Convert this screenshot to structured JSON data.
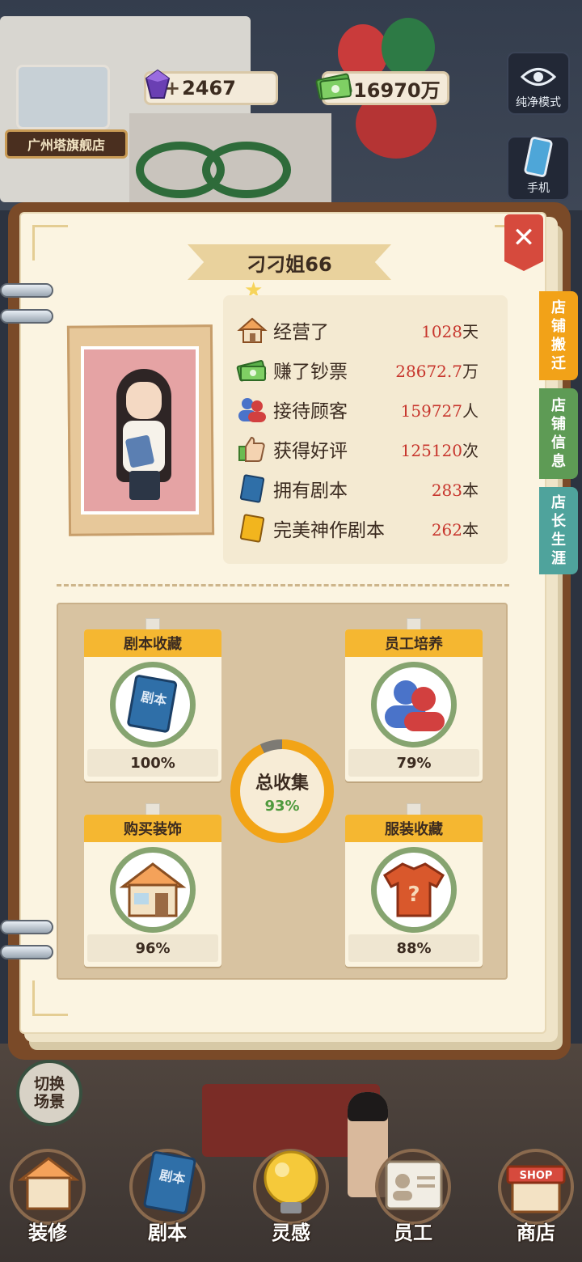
{
  "hud": {
    "store_name": "广州塔旗舰店",
    "gems": "2467",
    "cash": "16970万",
    "plus": "+",
    "pure_mode_label": "纯净模式",
    "phone_label": "手机"
  },
  "panel": {
    "owner_name": "刁刁姐66",
    "close_symbol": "✕",
    "tabs": [
      {
        "label": "店铺搬迁",
        "color": "#f2a218"
      },
      {
        "label": "店铺信息",
        "color": "#5e9b55"
      },
      {
        "label": "店长生涯",
        "color": "#4fa39c"
      }
    ],
    "stats": [
      {
        "icon": "house-icon",
        "label": "经营了",
        "value": "1028",
        "unit": "天"
      },
      {
        "icon": "money-icon",
        "label": "赚了钞票",
        "value": "28672.7",
        "unit": "万"
      },
      {
        "icon": "customers-icon",
        "label": "接待顾客",
        "value": "159727",
        "unit": "人"
      },
      {
        "icon": "thumbs-up-icon",
        "label": "获得好评",
        "value": "125120",
        "unit": "次"
      },
      {
        "icon": "script-book-icon",
        "label": "拥有剧本",
        "value": "283",
        "unit": "本"
      },
      {
        "icon": "gold-book-icon",
        "label": "完美神作剧本",
        "value": "262",
        "unit": "本"
      }
    ],
    "collections": [
      {
        "title": "剧本收藏",
        "percent": "100%",
        "progress": 1.0,
        "icon": "script-book-icon",
        "icon_text": "剧本"
      },
      {
        "title": "员工培养",
        "percent": "79%",
        "progress": 0.79,
        "icon": "staff-icon",
        "icon_text": ""
      },
      {
        "title": "购买装饰",
        "percent": "96%",
        "progress": 0.96,
        "icon": "shop-house-icon",
        "icon_text": ""
      },
      {
        "title": "服装收藏",
        "percent": "88%",
        "progress": 0.88,
        "icon": "shirt-icon",
        "icon_text": "?"
      }
    ],
    "total": {
      "label": "总收集",
      "percent": "93%",
      "progress": 0.93
    }
  },
  "bottom": {
    "switch_scene": "切换场景",
    "nav": [
      {
        "label": "装修",
        "icon": "decorate-icon"
      },
      {
        "label": "剧本",
        "icon": "script-icon",
        "icon_text": "剧本"
      },
      {
        "label": "灵感",
        "icon": "lightbulb-icon"
      },
      {
        "label": "员工",
        "icon": "staff-card-icon"
      },
      {
        "label": "商店",
        "icon": "shop-icon",
        "icon_text": "SHOP"
      }
    ]
  },
  "colors": {
    "accent_orange": "#f5b731",
    "value_red": "#c7362d",
    "ring_green": "#86a470",
    "close_red": "#d64a3d"
  }
}
